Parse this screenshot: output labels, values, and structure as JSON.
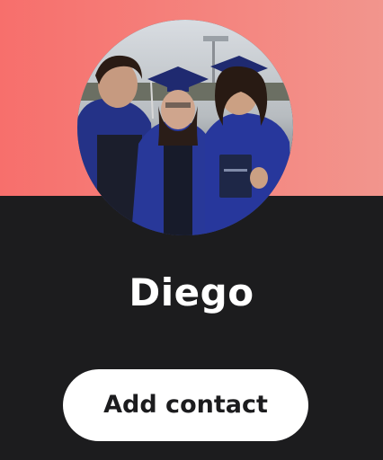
{
  "colors": {
    "banner_left": "#f76f6c",
    "banner_right": "#f2958d",
    "panel_bg": "#1c1c1e",
    "button_bg": "#ffffff",
    "button_text": "#1c1c1e",
    "name_text": "#ffffff"
  },
  "profile": {
    "name": "Diego",
    "avatar": "profile-photo"
  },
  "actions": {
    "add_contact_label": "Add contact"
  }
}
